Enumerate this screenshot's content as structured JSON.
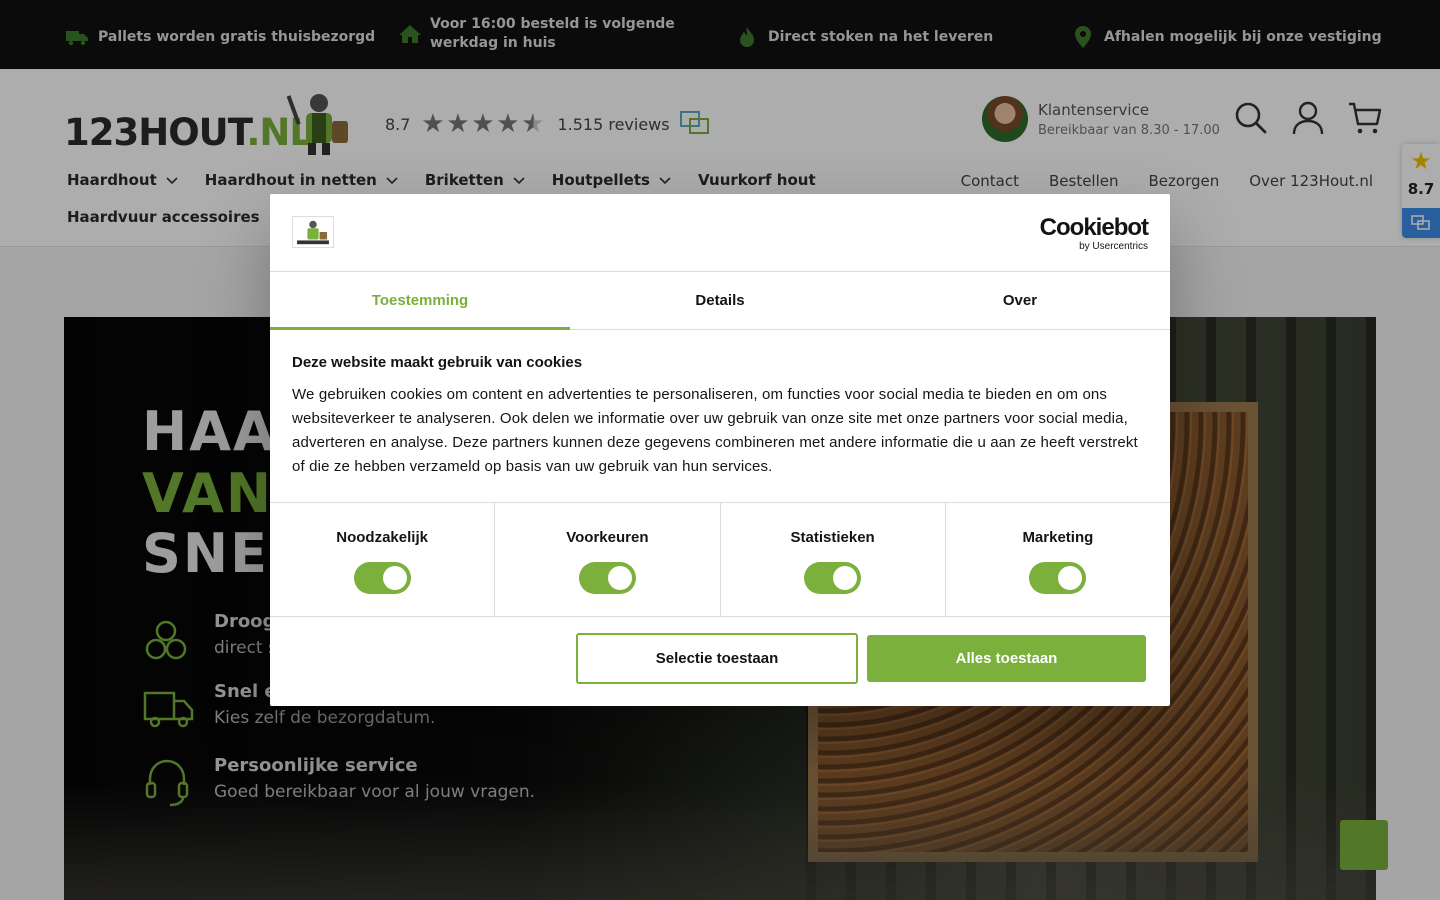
{
  "usp": [
    {
      "icon": "truck-icon",
      "text": "Pallets worden gratis thuisbezorgd"
    },
    {
      "icon": "home-icon",
      "text": "Voor 16:00 besteld is volgende werkdag in huis"
    },
    {
      "icon": "flame-icon",
      "text": "Direct stoken na het leveren"
    },
    {
      "icon": "location-pin-icon",
      "text": "Afhalen mogelijk bij onze vestiging"
    }
  ],
  "header": {
    "logo_main": "123HOUT",
    "logo_suffix": ".NL",
    "rating_score": "8.7",
    "rating_stars": 4.5,
    "reviews": "1.515 reviews",
    "service_title": "Klantenservice",
    "service_hours": "Bereikbaar van 8.30 - 17.00"
  },
  "nav": {
    "items": [
      {
        "label": "Haardhout",
        "dropdown": true
      },
      {
        "label": "Haardhout in netten",
        "dropdown": true
      },
      {
        "label": "Briketten",
        "dropdown": true
      },
      {
        "label": "Houtpellets",
        "dropdown": true
      },
      {
        "label": "Vuurkorf hout",
        "dropdown": false
      }
    ],
    "second_row": "Haardvuur accessoires",
    "secondary": [
      "Contact",
      "Bestellen",
      "Bezorgen",
      "Over 123Hout.nl"
    ]
  },
  "hero": {
    "title_line1": "HAA",
    "title_line2": "VAN",
    "title_line3": "SNEL",
    "features": [
      {
        "icon": "logs-icon",
        "title": "Droog",
        "sub": "direct s"
      },
      {
        "icon": "delivery-truck-icon",
        "title": "Snel e",
        "sub": "Kies zelf de bezorgdatum."
      },
      {
        "icon": "headset-icon",
        "title": "Persoonlijke service",
        "sub": "Goed bereikbaar voor al jouw vragen."
      }
    ]
  },
  "widget": {
    "score": "8.7"
  },
  "cookie": {
    "brand": "Cookiebot",
    "brand_sub": "by Usercentrics",
    "tabs": [
      "Toestemming",
      "Details",
      "Over"
    ],
    "active_tab": 0,
    "heading": "Deze website maakt gebruik van cookies",
    "body": "We gebruiken cookies om content en advertenties te personaliseren, om functies voor social media te bieden en om ons websiteverkeer te analyseren. Ook delen we informatie over uw gebruik van onze site met onze partners voor social media, adverteren en analyse. Deze partners kunnen deze gegevens combineren met andere informatie die u aan ze heeft verstrekt of die ze hebben verzameld op basis van uw gebruik van hun services.",
    "categories": [
      {
        "label": "Noodzakelijk",
        "checked": true
      },
      {
        "label": "Voorkeuren",
        "checked": true
      },
      {
        "label": "Statistieken",
        "checked": true
      },
      {
        "label": "Marketing",
        "checked": true
      }
    ],
    "btn_selection": "Selectie toestaan",
    "btn_all": "Alles toestaan"
  },
  "colors": {
    "accent": "#7ab03b",
    "dark": "#111111"
  }
}
